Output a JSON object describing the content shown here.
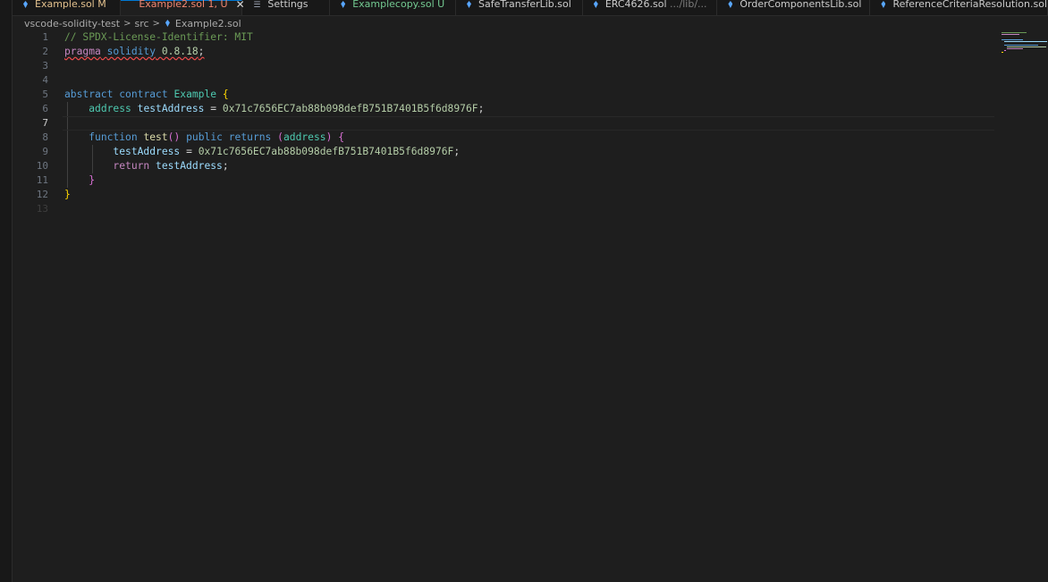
{
  "tabs": [
    {
      "name": "Example.sol",
      "status": "M",
      "color": "#e2c08d",
      "icon": "solidity-file-icon",
      "active": false
    },
    {
      "name": "Example2.sol",
      "status": "1, U",
      "color": "#f48771",
      "icon": "solidity-file-icon",
      "active": true
    },
    {
      "name": "Settings",
      "status": "",
      "color": "#cccccc",
      "icon": "gear-icon",
      "active": false
    },
    {
      "name": "Examplecopy.sol",
      "status": "U",
      "color": "#73c991",
      "icon": "solidity-file-icon",
      "active": false
    },
    {
      "name": "SafeTransferLib.sol",
      "status": "",
      "color": "#cccccc",
      "icon": "solidity-file-icon",
      "active": false
    },
    {
      "name": "ERC4626.sol",
      "status": "",
      "extra": ".../lib/...",
      "color": "#cccccc",
      "icon": "solidity-file-icon",
      "active": false
    },
    {
      "name": "OrderComponentsLib.sol",
      "status": "",
      "color": "#cccccc",
      "icon": "solidity-file-icon",
      "active": false
    },
    {
      "name": "ReferenceCriteriaResolution.sol",
      "status": "",
      "color": "#cccccc",
      "icon": "solidity-file-icon",
      "active": false
    }
  ],
  "breadcrumb": {
    "items": [
      "vscode-solidity-test",
      "src",
      "Example2.sol"
    ],
    "separator": ">"
  },
  "editor": {
    "current_line": 7,
    "line_numbers": [
      "1",
      "2",
      "3",
      "4",
      "5",
      "6",
      "7",
      "8",
      "9",
      "10",
      "11",
      "12",
      "13"
    ],
    "code_lines": [
      "// SPDX-License-Identifier: MIT",
      "pragma solidity 0.8.18;",
      "",
      "",
      "abstract contract Example {",
      "    address testAddress = 0x71c7656EC7ab88b098defB751B7401B5f6d8976F;",
      "",
      "    function test() public returns (address) {",
      "        testAddress = 0x71c7656EC7ab88b098defB751B7401B5f6d8976F;",
      "        return testAddress;",
      "    }",
      "}",
      ""
    ],
    "tokens": {
      "comment": "// SPDX-License-Identifier: MIT",
      "pragma": "pragma",
      "solidity": "solidity",
      "version": "0.8.18",
      "abstract": "abstract",
      "contract": "contract",
      "contract_name": "Example",
      "address_type": "address",
      "var_name": "testAddress",
      "address_literal": "0x71c7656EC7ab88b098defB751B7401B5f6d8976F",
      "function": "function",
      "fn_name": "test",
      "public": "public",
      "returns": "returns",
      "return": "return",
      "semicolon": ";",
      "equals": "=",
      "open_brace": "{",
      "close_brace": "}",
      "open_paren": "(",
      "close_paren": ")"
    }
  },
  "colors": {
    "background": "#1e1e1e",
    "tab_bar": "#181818",
    "active_tab_border": "#0078d4",
    "comment": "#6a9955",
    "keyword": "#569cd6",
    "control_keyword": "#c586c0",
    "number": "#b5cea8",
    "type": "#4ec9b0",
    "variable": "#9cdcfe",
    "function": "#dcdcaa",
    "error_squiggle": "#f14c4c"
  }
}
